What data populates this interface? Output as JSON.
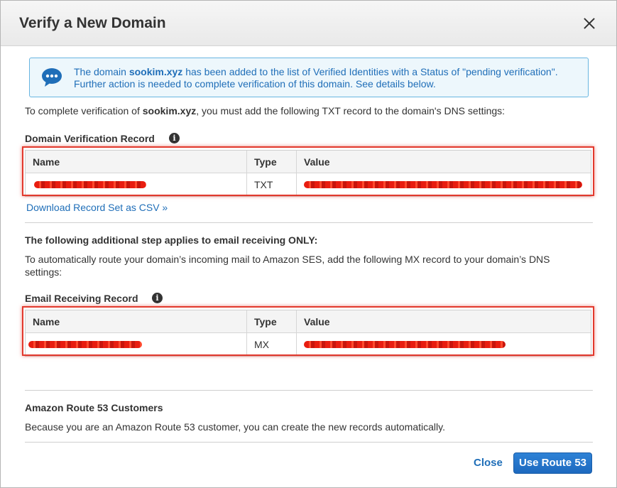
{
  "dialog": {
    "title": "Verify a New Domain"
  },
  "info": {
    "prefix": "The domain ",
    "domain": "sookim.xyz",
    "suffix": " has been added to the list of Verified Identities with a Status of \"pending verification\". Further action is needed to complete verification of this domain. See details below."
  },
  "intro": {
    "prefix": "To complete verification of ",
    "domain": "sookim.xyz",
    "suffix": ", you must add the following TXT record to the domain's DNS settings:"
  },
  "domain_record": {
    "label": "Domain Verification Record",
    "headers": {
      "name": "Name",
      "type": "Type",
      "value": "Value"
    },
    "row": {
      "name": "",
      "type": "TXT",
      "value": ""
    },
    "download_link": "Download Record Set as CSV »"
  },
  "email": {
    "heading": "The following additional step applies to email receiving ONLY:",
    "description": "To automatically route your domain’s incoming mail to Amazon SES, add the following MX record to your domain’s DNS settings:",
    "label": "Email Receiving Record",
    "headers": {
      "name": "Name",
      "type": "Type",
      "value": "Value"
    },
    "row": {
      "name": "",
      "type": "MX",
      "value": ""
    }
  },
  "route53": {
    "heading": "Amazon Route 53 Customers",
    "description": "Because you are an Amazon Route 53 customer, you can create the new records automatically."
  },
  "footer": {
    "close_label": "Close",
    "primary_label": "Use Route 53"
  },
  "icons": {
    "info": "i",
    "chat": "chat-bubble-icon",
    "close": "close-icon"
  },
  "colors": {
    "accent": "#1f6eb8",
    "info_border": "#68b5e0",
    "info_bg": "#edf7fc",
    "highlight": "#e2392d"
  }
}
